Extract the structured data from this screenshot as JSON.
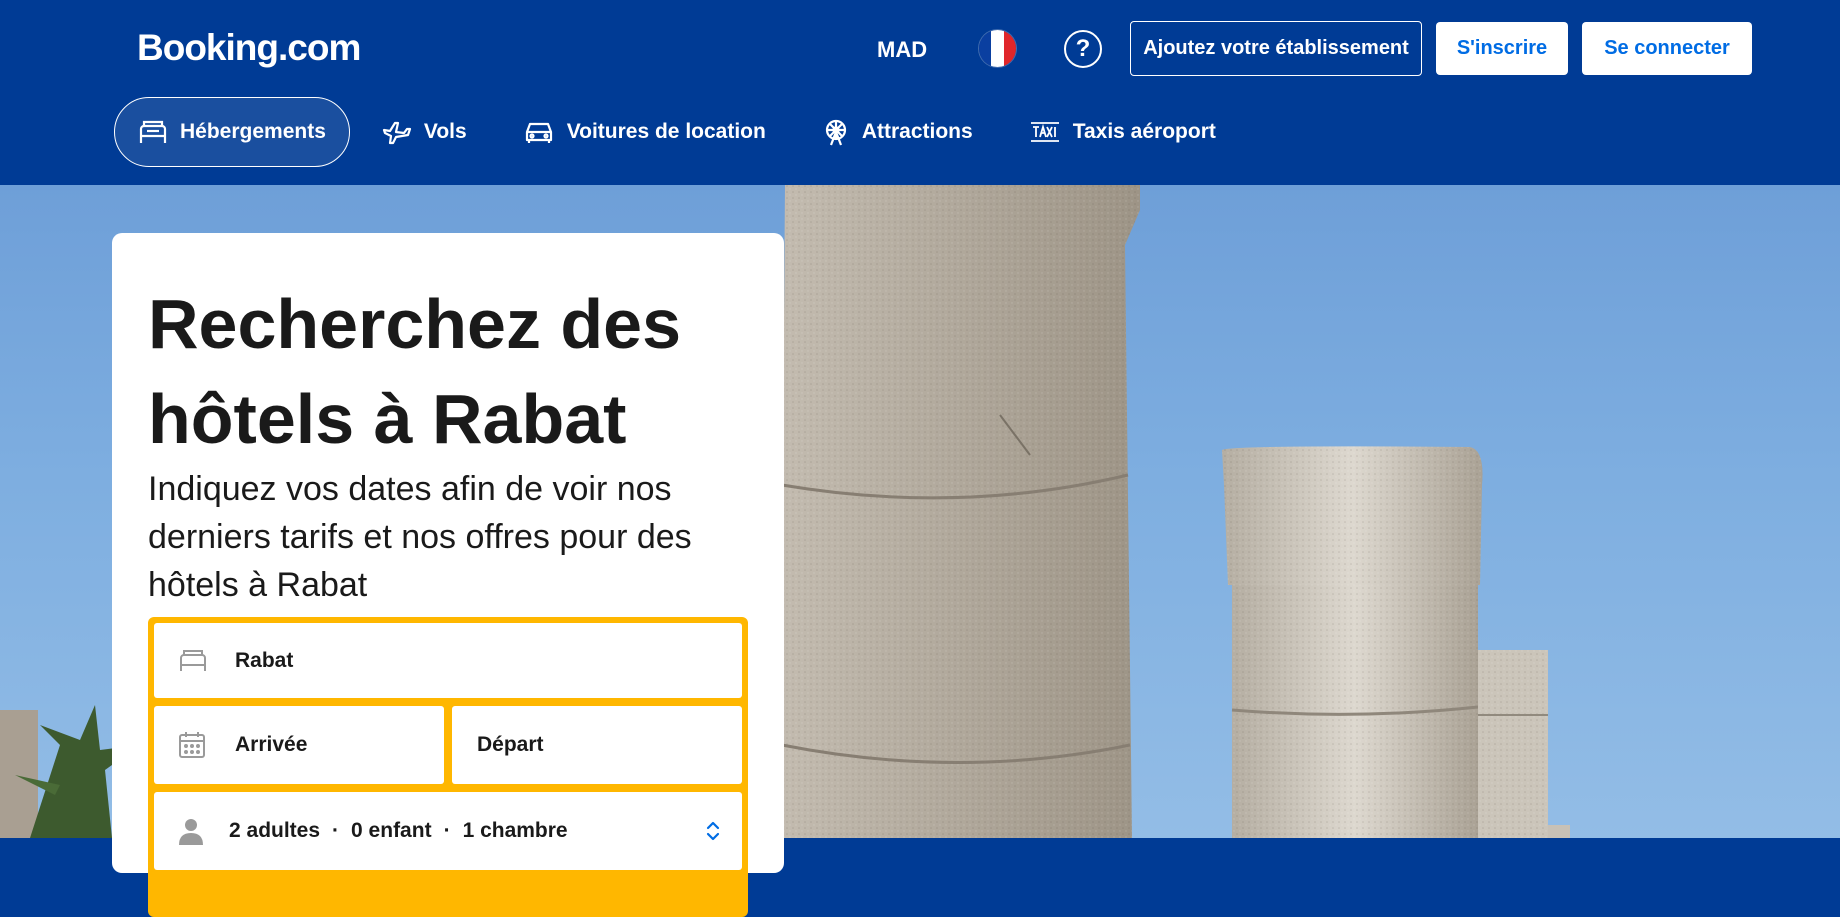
{
  "header": {
    "logo": "Booking.com",
    "currency": "MAD",
    "help_symbol": "?",
    "list_property": "Ajoutez votre établissement",
    "register": "S'inscrire",
    "sign_in": "Se connecter",
    "colors": {
      "brand": "#003b95",
      "accent": "#006ce4",
      "search_border": "#ffb700"
    }
  },
  "nav": {
    "items": [
      {
        "label": "Hébergements",
        "icon": "bed-icon",
        "active": true
      },
      {
        "label": "Vols",
        "icon": "plane-icon"
      },
      {
        "label": "Voitures de location",
        "icon": "car-icon"
      },
      {
        "label": "Attractions",
        "icon": "ferris-wheel-icon"
      },
      {
        "label": "Taxis aéroport",
        "icon": "taxi-icon"
      }
    ]
  },
  "card": {
    "title": "Recherchez des hôtels à Rabat",
    "subtitle": "Indiquez vos dates afin de voir nos derniers tarifs et nos offres pour des hôtels à Rabat"
  },
  "search": {
    "destination": "Rabat",
    "checkin_placeholder": "Arrivée",
    "checkout_placeholder": "Départ",
    "guests": {
      "adults": "2 adultes",
      "sep1": "·",
      "children": "0 enfant",
      "sep2": "·",
      "rooms": "1 chambre"
    }
  }
}
